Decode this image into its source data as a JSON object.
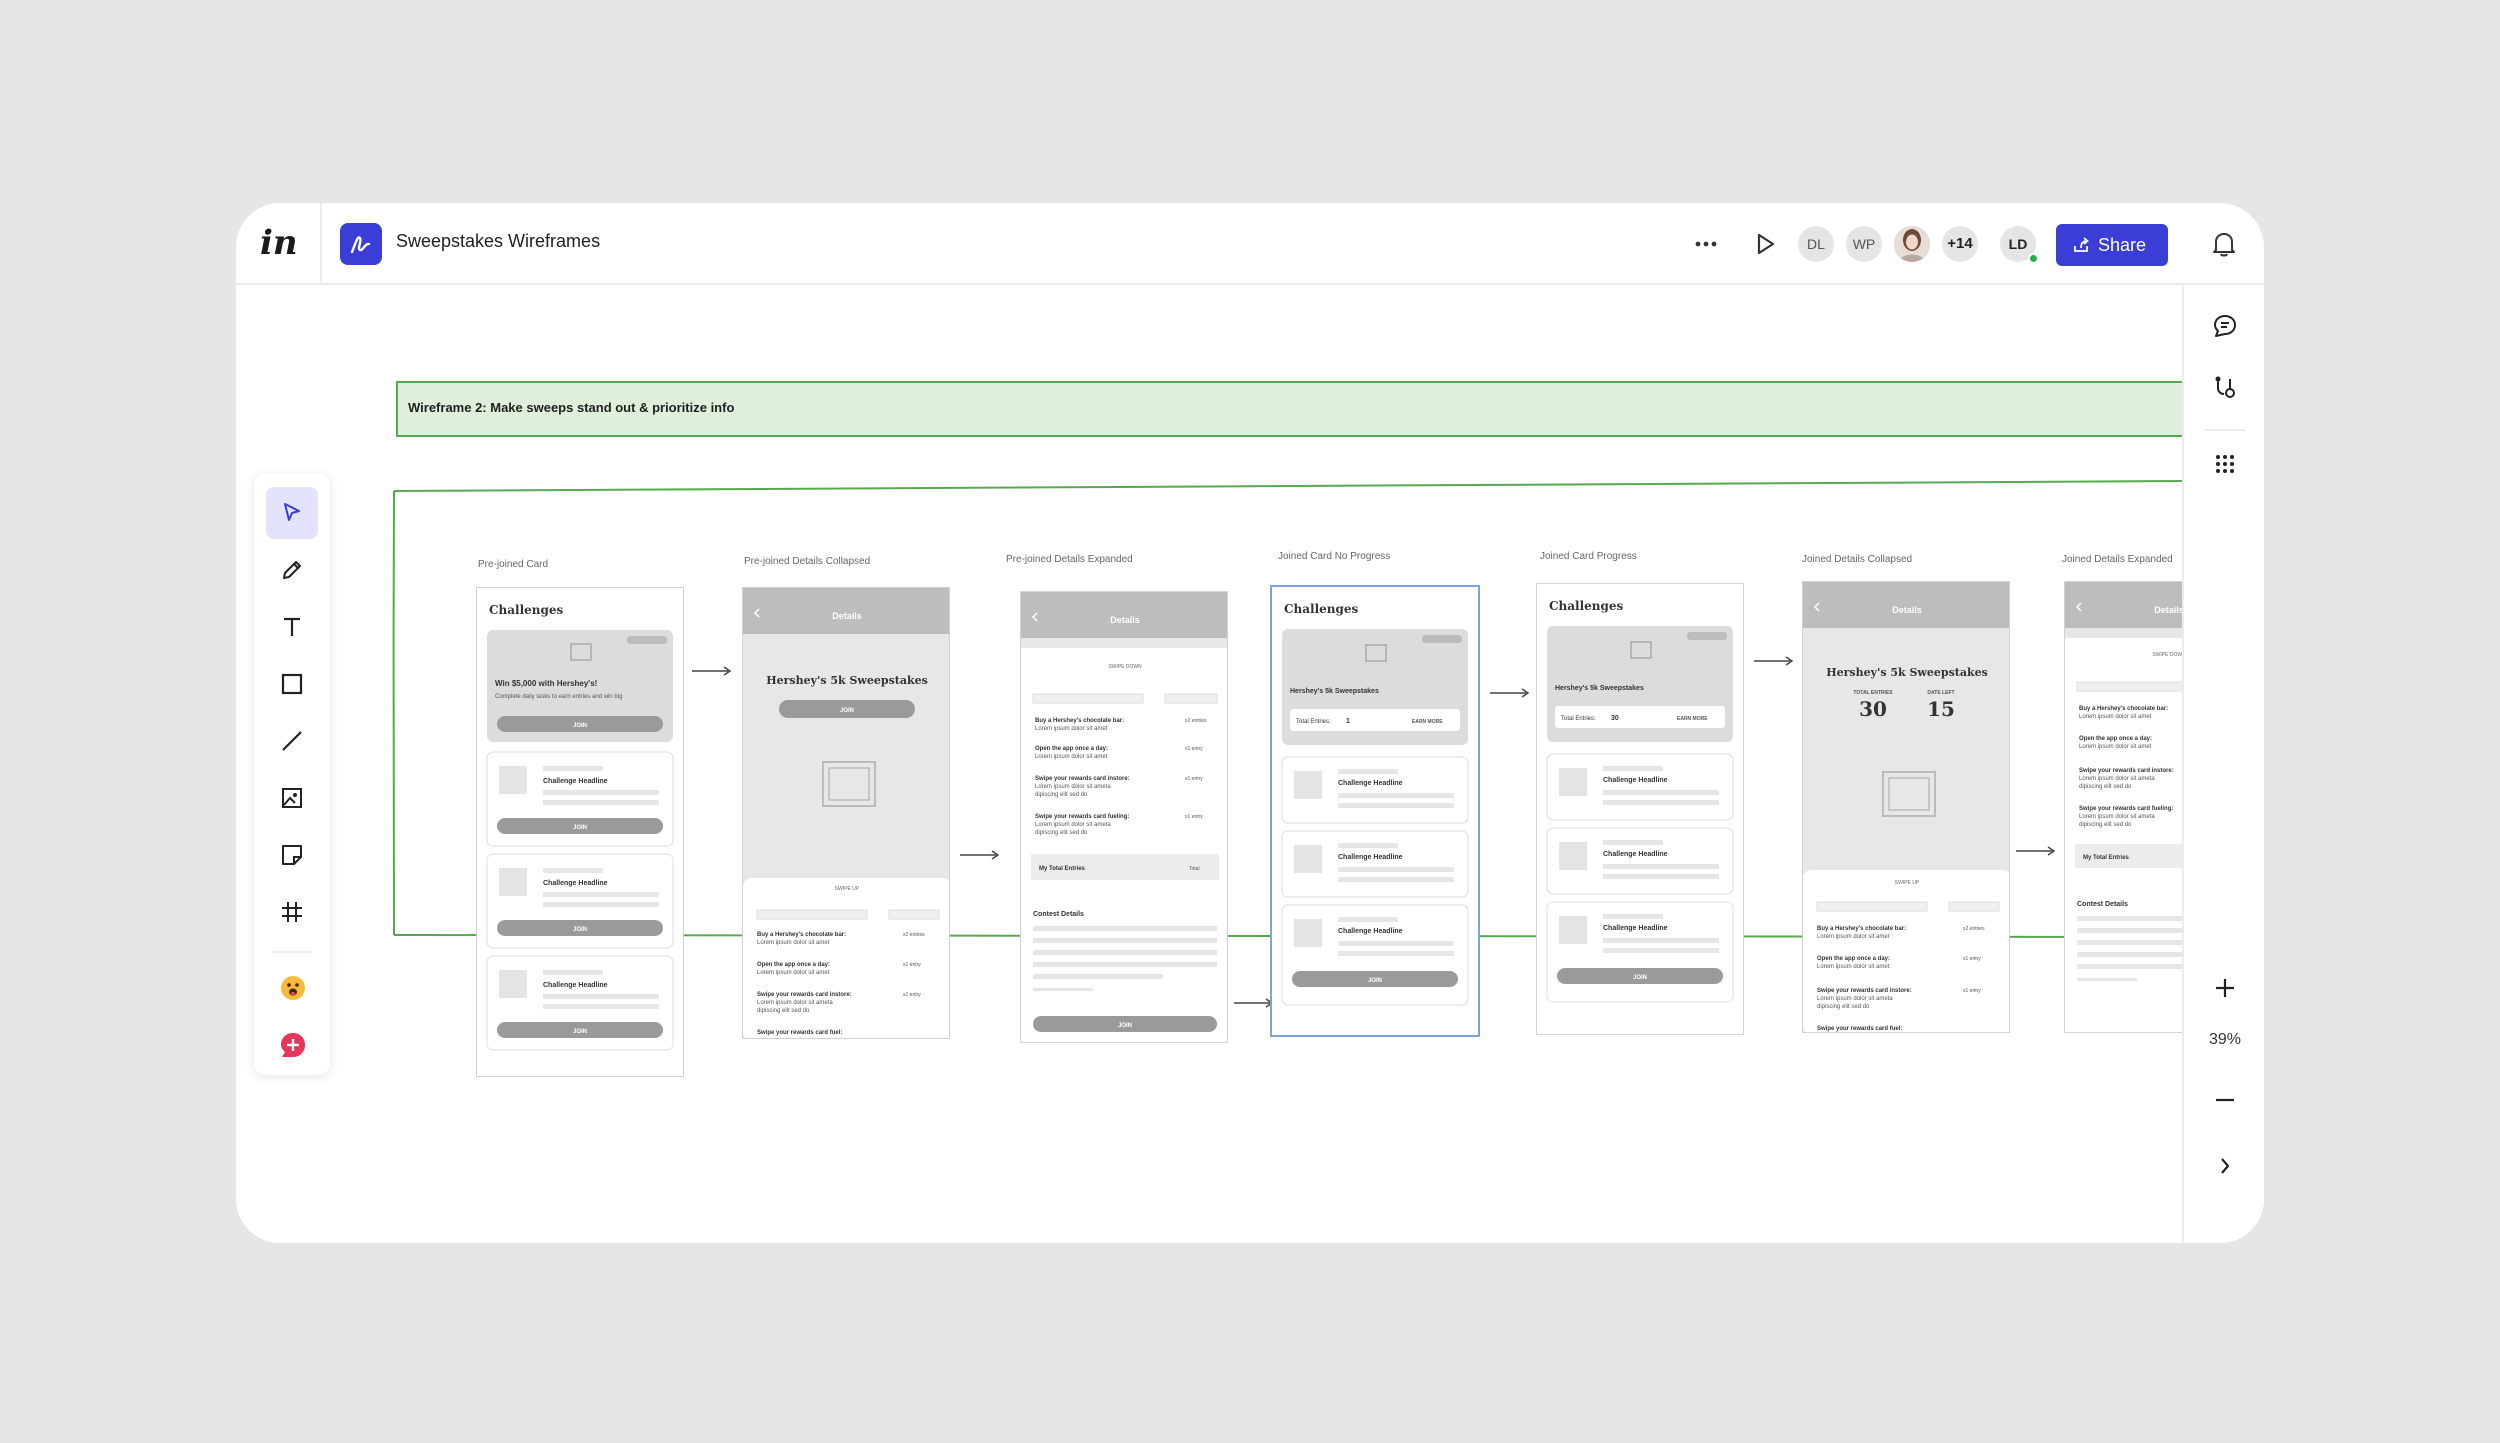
{
  "header": {
    "logo_text": "in",
    "document_title": "Sweepstakes Wireframes",
    "collaborators": [
      {
        "initials": "DL"
      },
      {
        "initials": "WP"
      },
      {
        "initials": ""
      }
    ],
    "more_collaborators": "+14",
    "current_user": "LD",
    "share_label": "Share",
    "brand_color": "#3B3ED6"
  },
  "toolbar": {
    "tools": [
      {
        "name": "select-tool",
        "icon": "pointer-icon",
        "active": true
      },
      {
        "name": "pen-tool",
        "icon": "pencil-icon"
      },
      {
        "name": "text-tool",
        "icon": "text-icon"
      },
      {
        "name": "rectangle-tool",
        "icon": "square-icon"
      },
      {
        "name": "line-tool",
        "icon": "line-icon"
      },
      {
        "name": "image-tool",
        "icon": "image-icon"
      },
      {
        "name": "sticky-note-tool",
        "icon": "sticky-note-icon"
      },
      {
        "name": "frame-tool",
        "icon": "hash-icon"
      },
      {
        "name": "emoji-tool",
        "icon": "smiley-icon"
      },
      {
        "name": "add-tool",
        "icon": "plus-bubble-icon"
      }
    ]
  },
  "right_panel": {
    "zoom_level": "39%",
    "icons": [
      "comment-icon",
      "inspect-icon",
      "apps-grid-icon",
      "zoom-in-icon",
      "zoom-out-icon",
      "chevron-right-icon"
    ]
  },
  "canvas": {
    "banner_text": "Wireframe 2: Make sweeps stand out & prioritize info",
    "frames": [
      {
        "label": "Pre-joined Card"
      },
      {
        "label": "Pre-joined Details Collapsed"
      },
      {
        "label": "Pre-joined Details Expanded"
      },
      {
        "label": "Joined Card No Progress"
      },
      {
        "label": "Joined Card Progress"
      },
      {
        "label": "Joined Details Collapsed"
      },
      {
        "label": "Joined Details Expanded"
      }
    ],
    "wf_text": {
      "challenges": "Challenges",
      "challenge_headline": "Challenge Headline",
      "join": "JOIN",
      "details": "Details",
      "sweep_title": "Hershey's 5k Sweepstakes",
      "win_title": "Win $5,000 with Hershey's!",
      "win_sub": "Complete daily tasks to earn entries and win big",
      "swipe_up": "SWIPE UP",
      "swipe_down": "SWIPE DOWN",
      "contest_details": "Contest Details",
      "my_total_entries": "My Total Entries",
      "total": "Total",
      "total_entries_label": "Total Entries:",
      "entries_1": "1",
      "entries_30": "30",
      "earn_more": "EARN MORE",
      "total_entries_caps": "TOTAL ENTRIES",
      "date_left_caps": "DATE LEFT",
      "big_30": "30",
      "big_15": "15",
      "task_1": "Buy a Hershey's chocolate bar:",
      "task_2": "Open the app once a day:",
      "task_3": "Swipe your rewards card instore:",
      "task_4": "Swipe your rewards card fueling:",
      "task_4_short": "Swipe your rewards card fuel:",
      "lorem": "Lorem ipsum dolor sit amet",
      "lorem_2": "Lorem ipsum dolor sit ameta",
      "lorem_3": "dipiscing elit sed do",
      "x2_entries": "x2 entries",
      "x1_entry": "x1 entry"
    }
  }
}
